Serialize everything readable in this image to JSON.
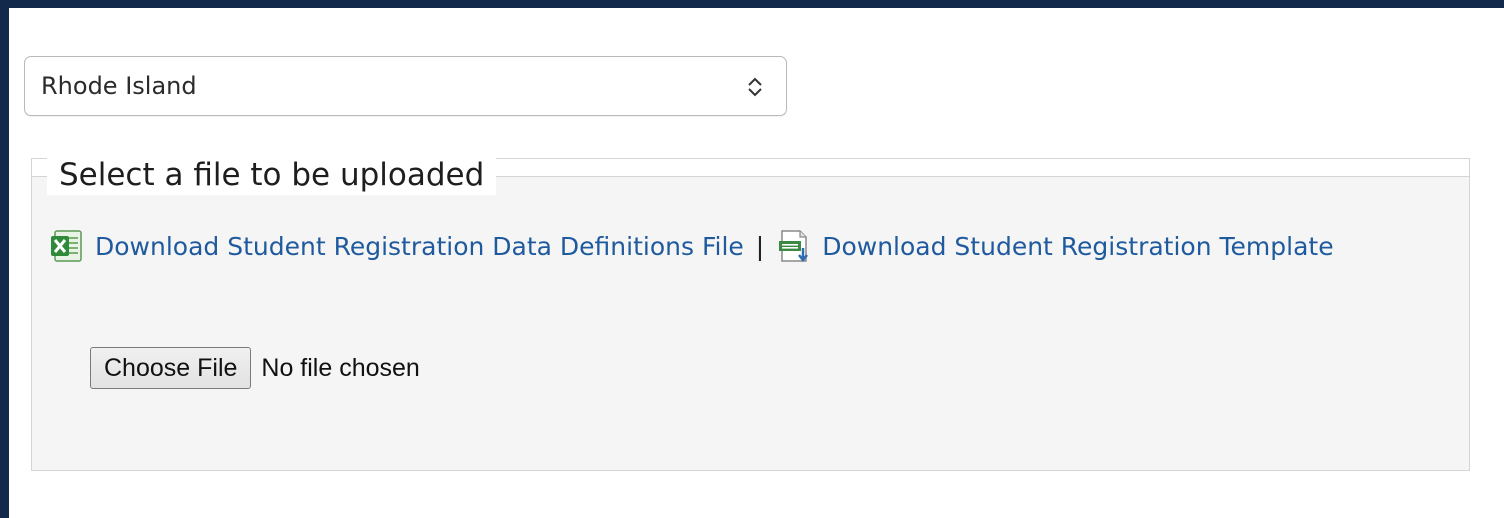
{
  "state_select": {
    "selected": "Rhode Island",
    "chevron_icon": "chevron-up-down-icon"
  },
  "upload_section": {
    "legend": "Select a file to be uploaded",
    "links": [
      {
        "icon": "excel-file-icon",
        "label": "Download Student Registration Data Definitions File"
      },
      {
        "icon": "csv-download-icon",
        "label": "Download Student Registration Template"
      }
    ],
    "separator": "|",
    "file_input": {
      "button_label": "Choose File",
      "status": "No file chosen"
    }
  },
  "colors": {
    "frame_border": "#13294b",
    "link": "#1f5a9e",
    "panel_background": "#f5f5f5"
  }
}
